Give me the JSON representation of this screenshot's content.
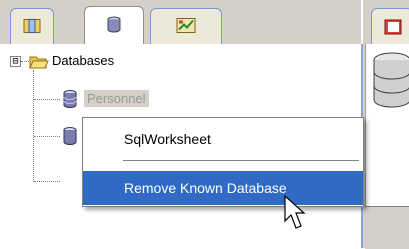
{
  "navigator": {
    "tabs": [
      {
        "icon": "connections-tab-icon"
      },
      {
        "icon": "databases-tab-icon",
        "active": true
      },
      {
        "icon": "reports-tab-icon"
      }
    ],
    "tree": {
      "root": {
        "label": "Databases",
        "expander": "⊟",
        "icon": "folder-open-icon"
      },
      "children": [
        {
          "label": "Personnel",
          "icon": "database-icon",
          "selected": true
        }
      ]
    }
  },
  "context_menu": {
    "items": [
      {
        "label": "SqlWorksheet",
        "highlighted": false
      },
      {
        "label": "Remove Known Database",
        "highlighted": true
      }
    ]
  },
  "colors": {
    "selection_blue": "#316ac5",
    "panel_gray": "#d4d0c8",
    "tab_border": "#7a96df"
  }
}
